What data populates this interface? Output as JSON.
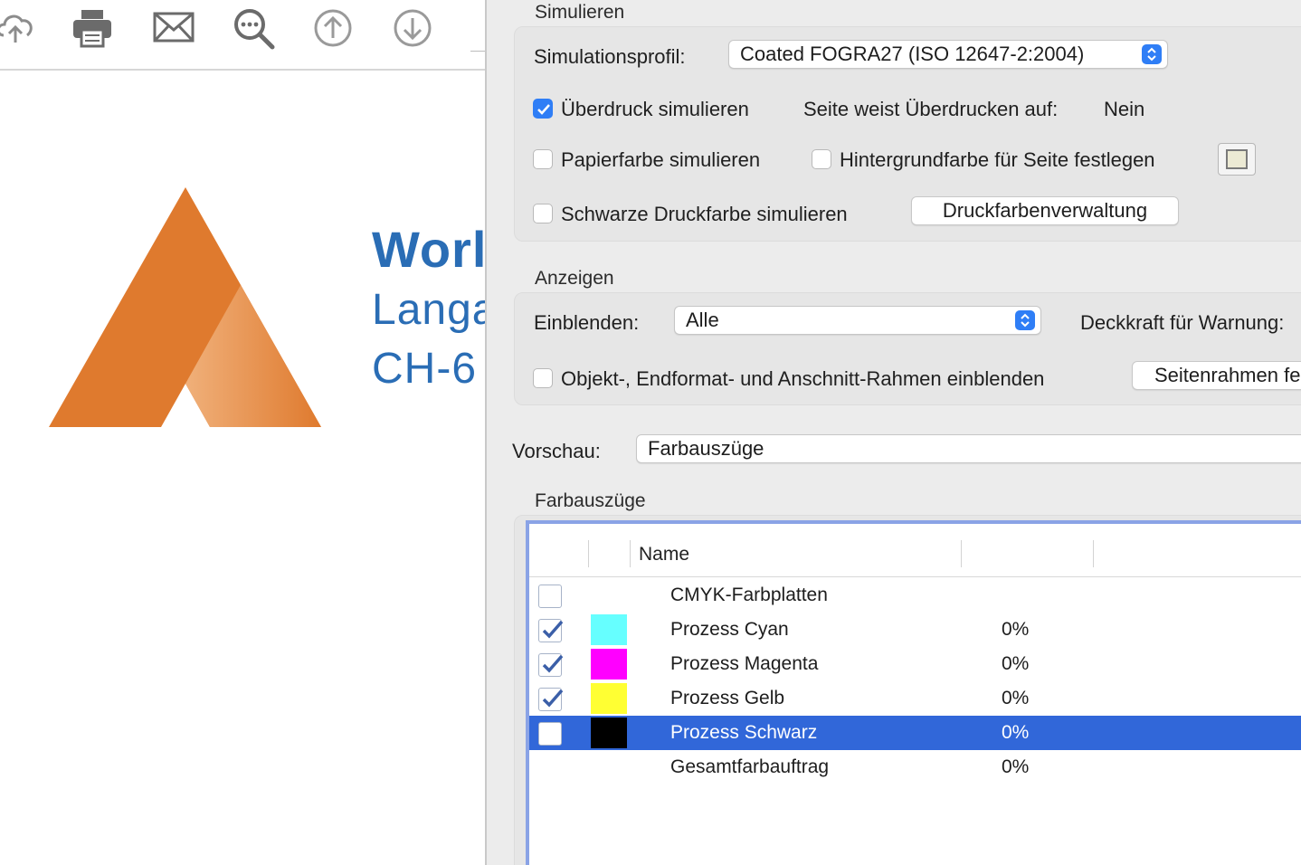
{
  "document": {
    "toolbar_icons": [
      "cloud-upload-icon",
      "print-icon",
      "mail-icon",
      "zoom-search-icon",
      "arrow-up-icon",
      "arrow-down-icon"
    ],
    "company_name": "Worl",
    "address_line1": "Langa",
    "address_line2": "CH-6",
    "colors": {
      "logo_orange": "#df7a2e",
      "text_blue": "#2a6db5"
    }
  },
  "dialog": {
    "simulate": {
      "title": "Simulieren",
      "profile_label": "Simulationsprofil:",
      "profile_value": "Coated FOGRA27 (ISO 12647-2:2004)",
      "overprint_label": "Überdruck simulieren",
      "overprint_checked": true,
      "page_has_overprint_label": "Seite weist Überdrucken auf:",
      "page_has_overprint_value": "Nein",
      "paper_color_label": "Papierfarbe simulieren",
      "paper_color_checked": false,
      "bg_color_label": "Hintergrundfarbe für Seite festlegen",
      "bg_color_checked": false,
      "bg_color_swatch": "#ecead4",
      "black_ink_label": "Schwarze Druckfarbe simulieren",
      "black_ink_checked": false,
      "ink_manager_button": "Druckfarbenverwaltung"
    },
    "display": {
      "title": "Anzeigen",
      "show_label": "Einblenden:",
      "show_value": "Alle",
      "opacity_label": "Deckkraft für Warnung:",
      "boxes_label": "Objekt-, Endformat- und Anschnitt-Rahmen einblenden",
      "boxes_checked": false,
      "page_boxes_button": "Seitenrahmen fe"
    },
    "preview": {
      "label": "Vorschau:",
      "value": "Farbauszüge"
    },
    "separations": {
      "title": "Farbauszüge",
      "column_name": "Name",
      "rows": [
        {
          "checked": false,
          "swatch": null,
          "name": "CMYK-Farbplatten",
          "coverage": "",
          "selected": false,
          "show_checkbox": true
        },
        {
          "checked": true,
          "swatch": "#66ffff",
          "name": "Prozess Cyan",
          "coverage": "0%",
          "selected": false,
          "show_checkbox": true
        },
        {
          "checked": true,
          "swatch": "#ff00ff",
          "name": "Prozess Magenta",
          "coverage": "0%",
          "selected": false,
          "show_checkbox": true
        },
        {
          "checked": true,
          "swatch": "#ffff33",
          "name": "Prozess Gelb",
          "coverage": "0%",
          "selected": false,
          "show_checkbox": true
        },
        {
          "checked": false,
          "swatch": "#000000",
          "name": "Prozess Schwarz",
          "coverage": "0%",
          "selected": true,
          "show_checkbox": true
        },
        {
          "checked": false,
          "swatch": null,
          "name": "Gesamtfarbauftrag",
          "coverage": "0%",
          "selected": false,
          "show_checkbox": false
        }
      ],
      "selection_color": "#3167d9"
    },
    "accent_color": "#2f7ef6"
  }
}
